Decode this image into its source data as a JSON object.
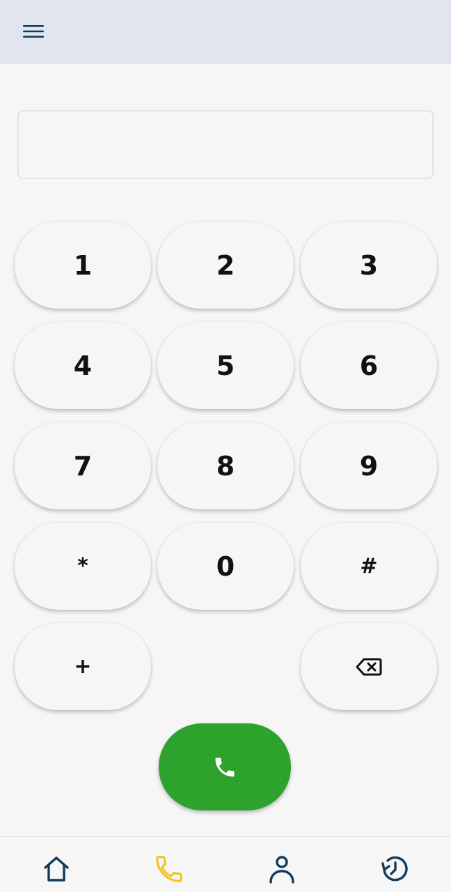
{
  "header": {
    "menu_icon": "hamburger-menu-icon"
  },
  "dialer": {
    "input_value": "",
    "keys": [
      "1",
      "2",
      "3",
      "4",
      "5",
      "6",
      "7",
      "8",
      "9",
      "*",
      "0",
      "#",
      "+"
    ],
    "backspace_icon": "backspace-icon",
    "call_icon": "phone-icon",
    "call_color": "#2da32e"
  },
  "bottom_nav": {
    "items": [
      {
        "icon": "home-icon",
        "active": false
      },
      {
        "icon": "phone-icon",
        "active": true
      },
      {
        "icon": "person-icon",
        "active": false
      },
      {
        "icon": "history-icon",
        "active": false
      }
    ],
    "active_color": "#f2c41a",
    "inactive_color": "#123a5a"
  }
}
